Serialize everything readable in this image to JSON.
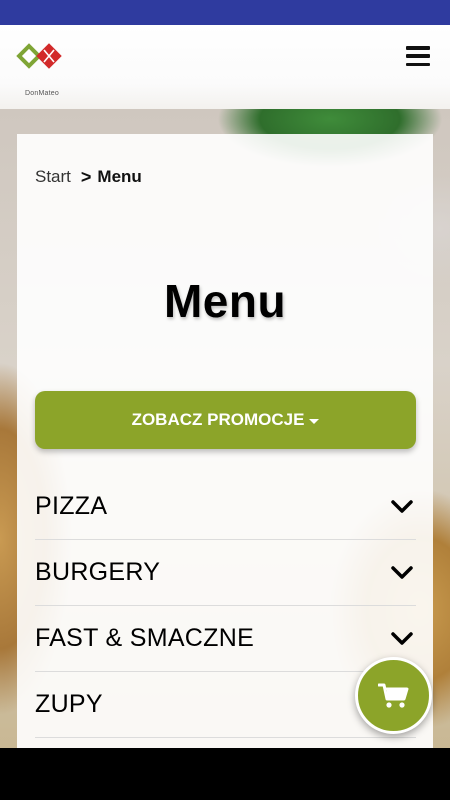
{
  "header": {
    "logo_text": "DonMateo",
    "logo_icon": "donmateo-logo-icon",
    "menu_icon": "hamburger-menu-icon"
  },
  "breadcrumb": {
    "start": "Start",
    "separator": ">",
    "current": "Menu"
  },
  "page_title": "Menu",
  "promo_button": {
    "label": "ZOBACZ PROMOCJE",
    "icon": "caret-down-icon"
  },
  "menu": {
    "items": [
      {
        "label": "PIZZA",
        "icon": "chevron-down-icon"
      },
      {
        "label": "BURGERY",
        "icon": "chevron-down-icon"
      },
      {
        "label": "FAST & SMACZNE",
        "icon": "chevron-down-icon"
      },
      {
        "label": "ZUPY",
        "icon": "chevron-down-icon"
      }
    ]
  },
  "cart_button": {
    "icon": "shopping-cart-icon"
  },
  "colors": {
    "status_bar": "#2f3b9f",
    "accent_green": "#8ca429",
    "text": "#000000"
  }
}
